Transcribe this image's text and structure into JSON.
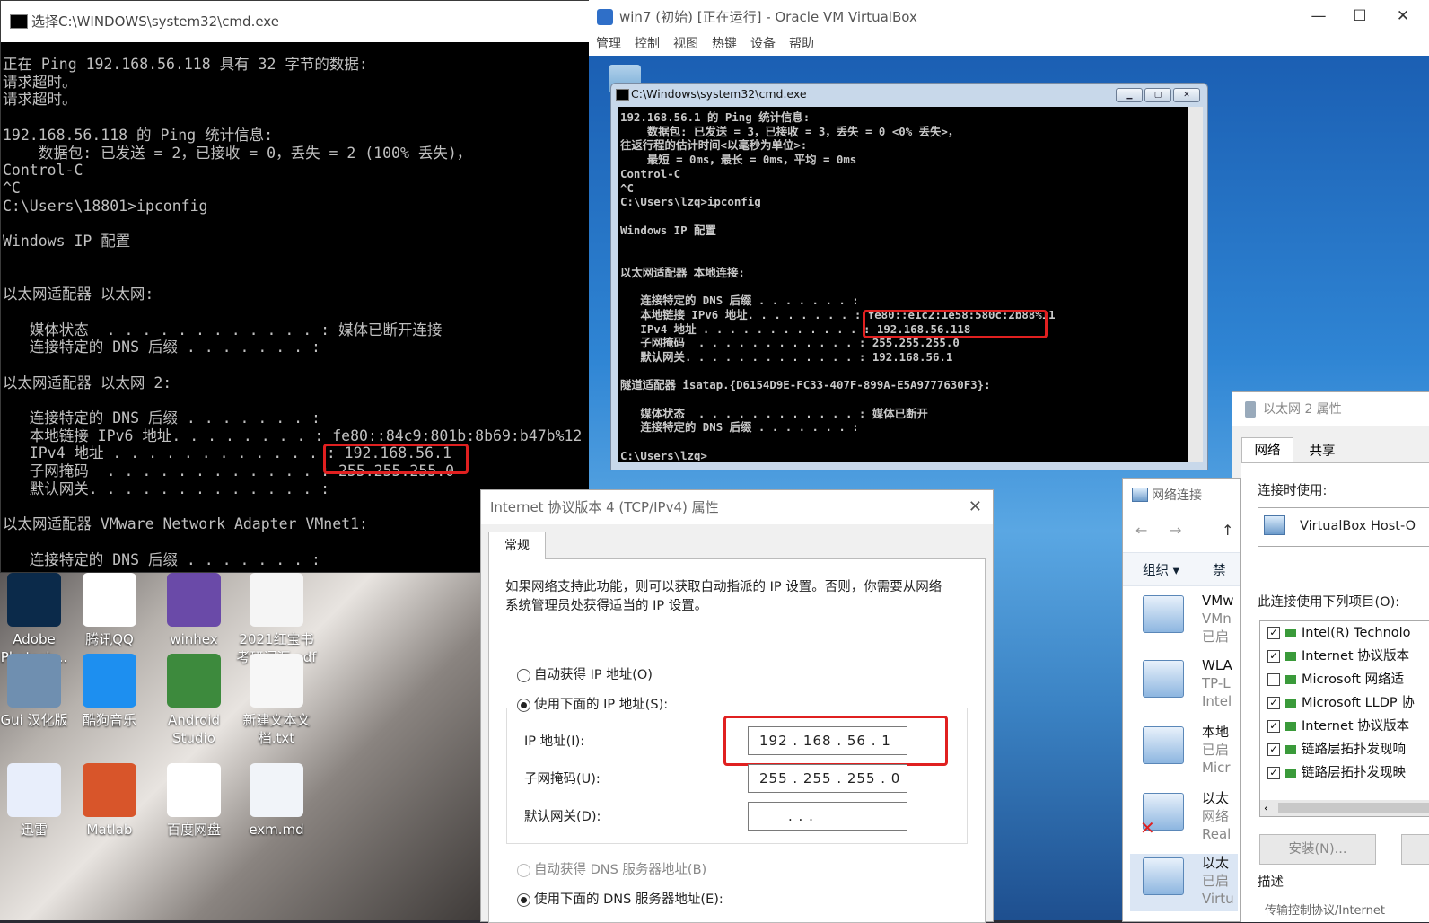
{
  "host_cmd": {
    "title": "选择C:\\WINDOWS\\system32\\cmd.exe",
    "lines": [
      "正在 Ping 192.168.56.118 具有 32 字节的数据:",
      "请求超时。",
      "请求超时。",
      "",
      "192.168.56.118 的 Ping 统计信息:",
      "    数据包: 已发送 = 2，已接收 = 0，丢失 = 2 (100% 丢失)，",
      "Control-C",
      "^C",
      "C:\\Users\\18801>ipconfig",
      "",
      "Windows IP 配置",
      "",
      "",
      "以太网适配器 以太网:",
      "",
      "   媒体状态  . . . . . . . . . . . . : 媒体已断开连接",
      "   连接特定的 DNS 后缀 . . . . . . . :",
      "",
      "以太网适配器 以太网 2:",
      "",
      "   连接特定的 DNS 后缀 . . . . . . . :",
      "   本地链接 IPv6 地址. . . . . . . . : fe80::84c9:801b:8b69:b47b%12",
      "   IPv4 地址 . . . . . . . . . . . . : 192.168.56.1",
      "   子网掩码  . . . . . . . . . . . . : 255.255.255.0",
      "   默认网关. . . . . . . . . . . . . :",
      "",
      "以太网适配器 VMware Network Adapter VMnet1:",
      "",
      "   连接特定的 DNS 后缀 . . . . . . . :"
    ]
  },
  "desktop_icons": [
    {
      "label": "Adobe\nPhotosh...",
      "color": "#0b2a4a"
    },
    {
      "label": "腾讯QQ",
      "color": "#ffffff"
    },
    {
      "label": "winhex",
      "color": "#6a4aa8"
    },
    {
      "label": "2021红宝书\n考研词汇.pdf",
      "color": "#f5f5f5"
    },
    {
      "label": "Gui 汉化版",
      "color": "#6f8fb0"
    },
    {
      "label": "酷狗音乐",
      "color": "#1d8ff0"
    },
    {
      "label": "Android\nStudio",
      "color": "#3d8a3d"
    },
    {
      "label": "新建文本文\n档.txt",
      "color": "#f7f7f7"
    },
    {
      "label": "迅雷",
      "color": "#e8eefb"
    },
    {
      "label": "Matlab",
      "color": "#d8552a"
    },
    {
      "label": "百度网盘",
      "color": "#ffffff"
    },
    {
      "label": "exm.md",
      "color": "#f1f4f9"
    }
  ],
  "vbox": {
    "title": "win7 (初始) [正在运行] - Oracle VM VirtualBox",
    "minimize": "—",
    "maximize": "☐",
    "close": "✕",
    "menu": [
      "管理",
      "控制",
      "视图",
      "热键",
      "设备",
      "帮助"
    ]
  },
  "vm_cmd": {
    "title": "C:\\Windows\\system32\\cmd.exe",
    "lines": [
      "192.168.56.1 的 Ping 统计信息:",
      "    数据包: 已发送 = 3，已接收 = 3，丢失 = 0 <0% 丢失>，",
      "往返行程的估计时间<以毫秒为单位>:",
      "    最短 = 0ms，最长 = 0ms，平均 = 0ms",
      "Control-C",
      "^C",
      "C:\\Users\\lzq>ipconfig",
      "",
      "Windows IP 配置",
      "",
      "",
      "以太网适配器 本地连接:",
      "",
      "   连接特定的 DNS 后缀 . . . . . . . :",
      "   本地链接 IPv6 地址. . . . . . . . : fe80::e1c2:1e58:580c:2b88%11",
      "   IPv4 地址 . . . . . . . . . . . . : 192.168.56.118",
      "   子网掩码  . . . . . . . . . . . . : 255.255.255.0",
      "   默认网关. . . . . . . . . . . . . : 192.168.56.1",
      "",
      "隧道适配器 isatap.{D6154D9E-FC33-407F-899A-E5A9777630F3}:",
      "",
      "   媒体状态  . . . . . . . . . . . . : 媒体已断开",
      "   连接特定的 DNS 后缀 . . . . . . . :",
      "",
      "C:\\Users\\lzq>"
    ]
  },
  "ipv4_dialog": {
    "title": "Internet 协议版本 4 (TCP/IPv4) 属性",
    "close": "✕",
    "tab": "常规",
    "description": "如果网络支持此功能，则可以获取自动指派的 IP 设置。否则，你需要从网络系统管理员处获得适当的 IP 设置。",
    "radio_auto_ip": "自动获得 IP 地址(O)",
    "radio_manual_ip": "使用下面的 IP 地址(S):",
    "ip_label": "IP 地址(I):",
    "ip_value": "192 . 168 . 56  .  1",
    "mask_label": "子网掩码(U):",
    "mask_value": "255 . 255 . 255 .  0",
    "gateway_label": "默认网关(D):",
    "gateway_value": ".       .       .",
    "radio_auto_dns": "自动获得 DNS 服务器地址(B)",
    "radio_manual_dns": "使用下面的 DNS 服务器地址(E):"
  },
  "net_connections": {
    "title": "网络连接",
    "toolbar_organize": "组织 ▾",
    "toolbar_disable": "禁",
    "items": [
      {
        "name": "VMw",
        "line2": "VMn",
        "line3": "已启"
      },
      {
        "name": "WLA",
        "line2": "TP-L",
        "line3": "Intel"
      },
      {
        "name": "本地",
        "line2": "已启",
        "line3": "Micr"
      },
      {
        "name": "以太",
        "line2": "网络",
        "line3": "Real"
      },
      {
        "name": "以太",
        "line2": "已启",
        "line3": "Virtu"
      }
    ]
  },
  "eth2_props": {
    "title": "以太网 2 属性",
    "tab_network": "网络",
    "tab_share": "共享",
    "connect_using_label": "连接时使用:",
    "adapter_name": "VirtualBox Host-O",
    "components_label": "此连接使用下列项目(O):",
    "components": [
      {
        "checked": true,
        "label": "Intel(R) Technolo"
      },
      {
        "checked": true,
        "label": "Internet 协议版本"
      },
      {
        "checked": false,
        "label": "Microsoft 网络适"
      },
      {
        "checked": true,
        "label": "Microsoft LLDP 协"
      },
      {
        "checked": true,
        "label": "Internet 协议版本"
      },
      {
        "checked": true,
        "label": "链路层拓扑发现响"
      },
      {
        "checked": true,
        "label": "链路层拓扑发现映"
      }
    ],
    "install_button": "安装(N)...",
    "description_label": "描述",
    "description_text": "传输控制协议/Internet"
  }
}
